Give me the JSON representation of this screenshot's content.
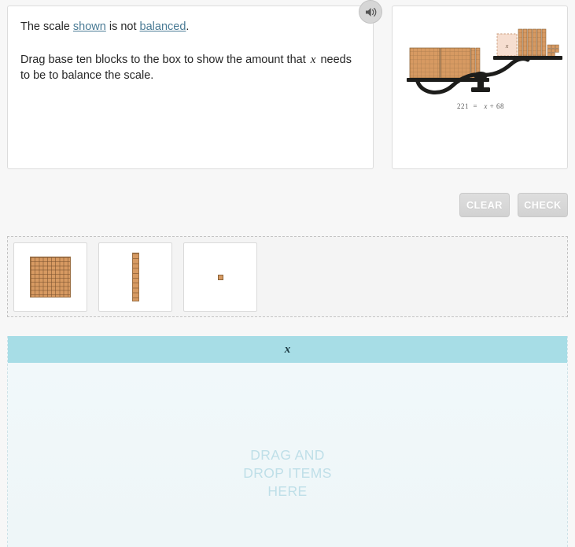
{
  "prompt": {
    "line1_prefix": "The scale ",
    "link_shown": "shown",
    "line1_middle": " is not ",
    "link_balanced": "balanced",
    "line1_suffix": ".",
    "line2_prefix": "Drag base ten blocks to the box to show the amount that ",
    "line2_variable": "x",
    "line2_suffix": " needs to be to balance the scale."
  },
  "audio": {
    "button_name": "speaker-icon",
    "tooltip": "Listen"
  },
  "scale": {
    "equation_left": "221",
    "equation_operator": "=",
    "equation_right_variable": "x",
    "equation_right_plus": "+",
    "equation_right_constant": "68",
    "equation_full": "221 = x + 68",
    "left_pan_value": 221,
    "right_pan_known_value": 68,
    "unknown_label": "x",
    "tilt": "left-side-down",
    "block_color": "#d79a62",
    "unknown_box_color": "#f6ded0"
  },
  "toolbar": {
    "clear_label": "CLEAR",
    "check_label": "CHECK"
  },
  "palette": {
    "items": [
      {
        "name": "hundred-flat",
        "label": "hundred flat",
        "value": 100
      },
      {
        "name": "ten-rod",
        "label": "ten rod",
        "value": 10
      },
      {
        "name": "unit-cube",
        "label": "unit cube",
        "value": 1
      }
    ]
  },
  "dropzone": {
    "header_label": "x",
    "hint_line1": "DRAG AND",
    "hint_line2": "DROP ITEMS",
    "hint_line3": "HERE",
    "header_color": "#a7dde6",
    "hint_color": "#bfdfe8",
    "item_count": 0
  }
}
